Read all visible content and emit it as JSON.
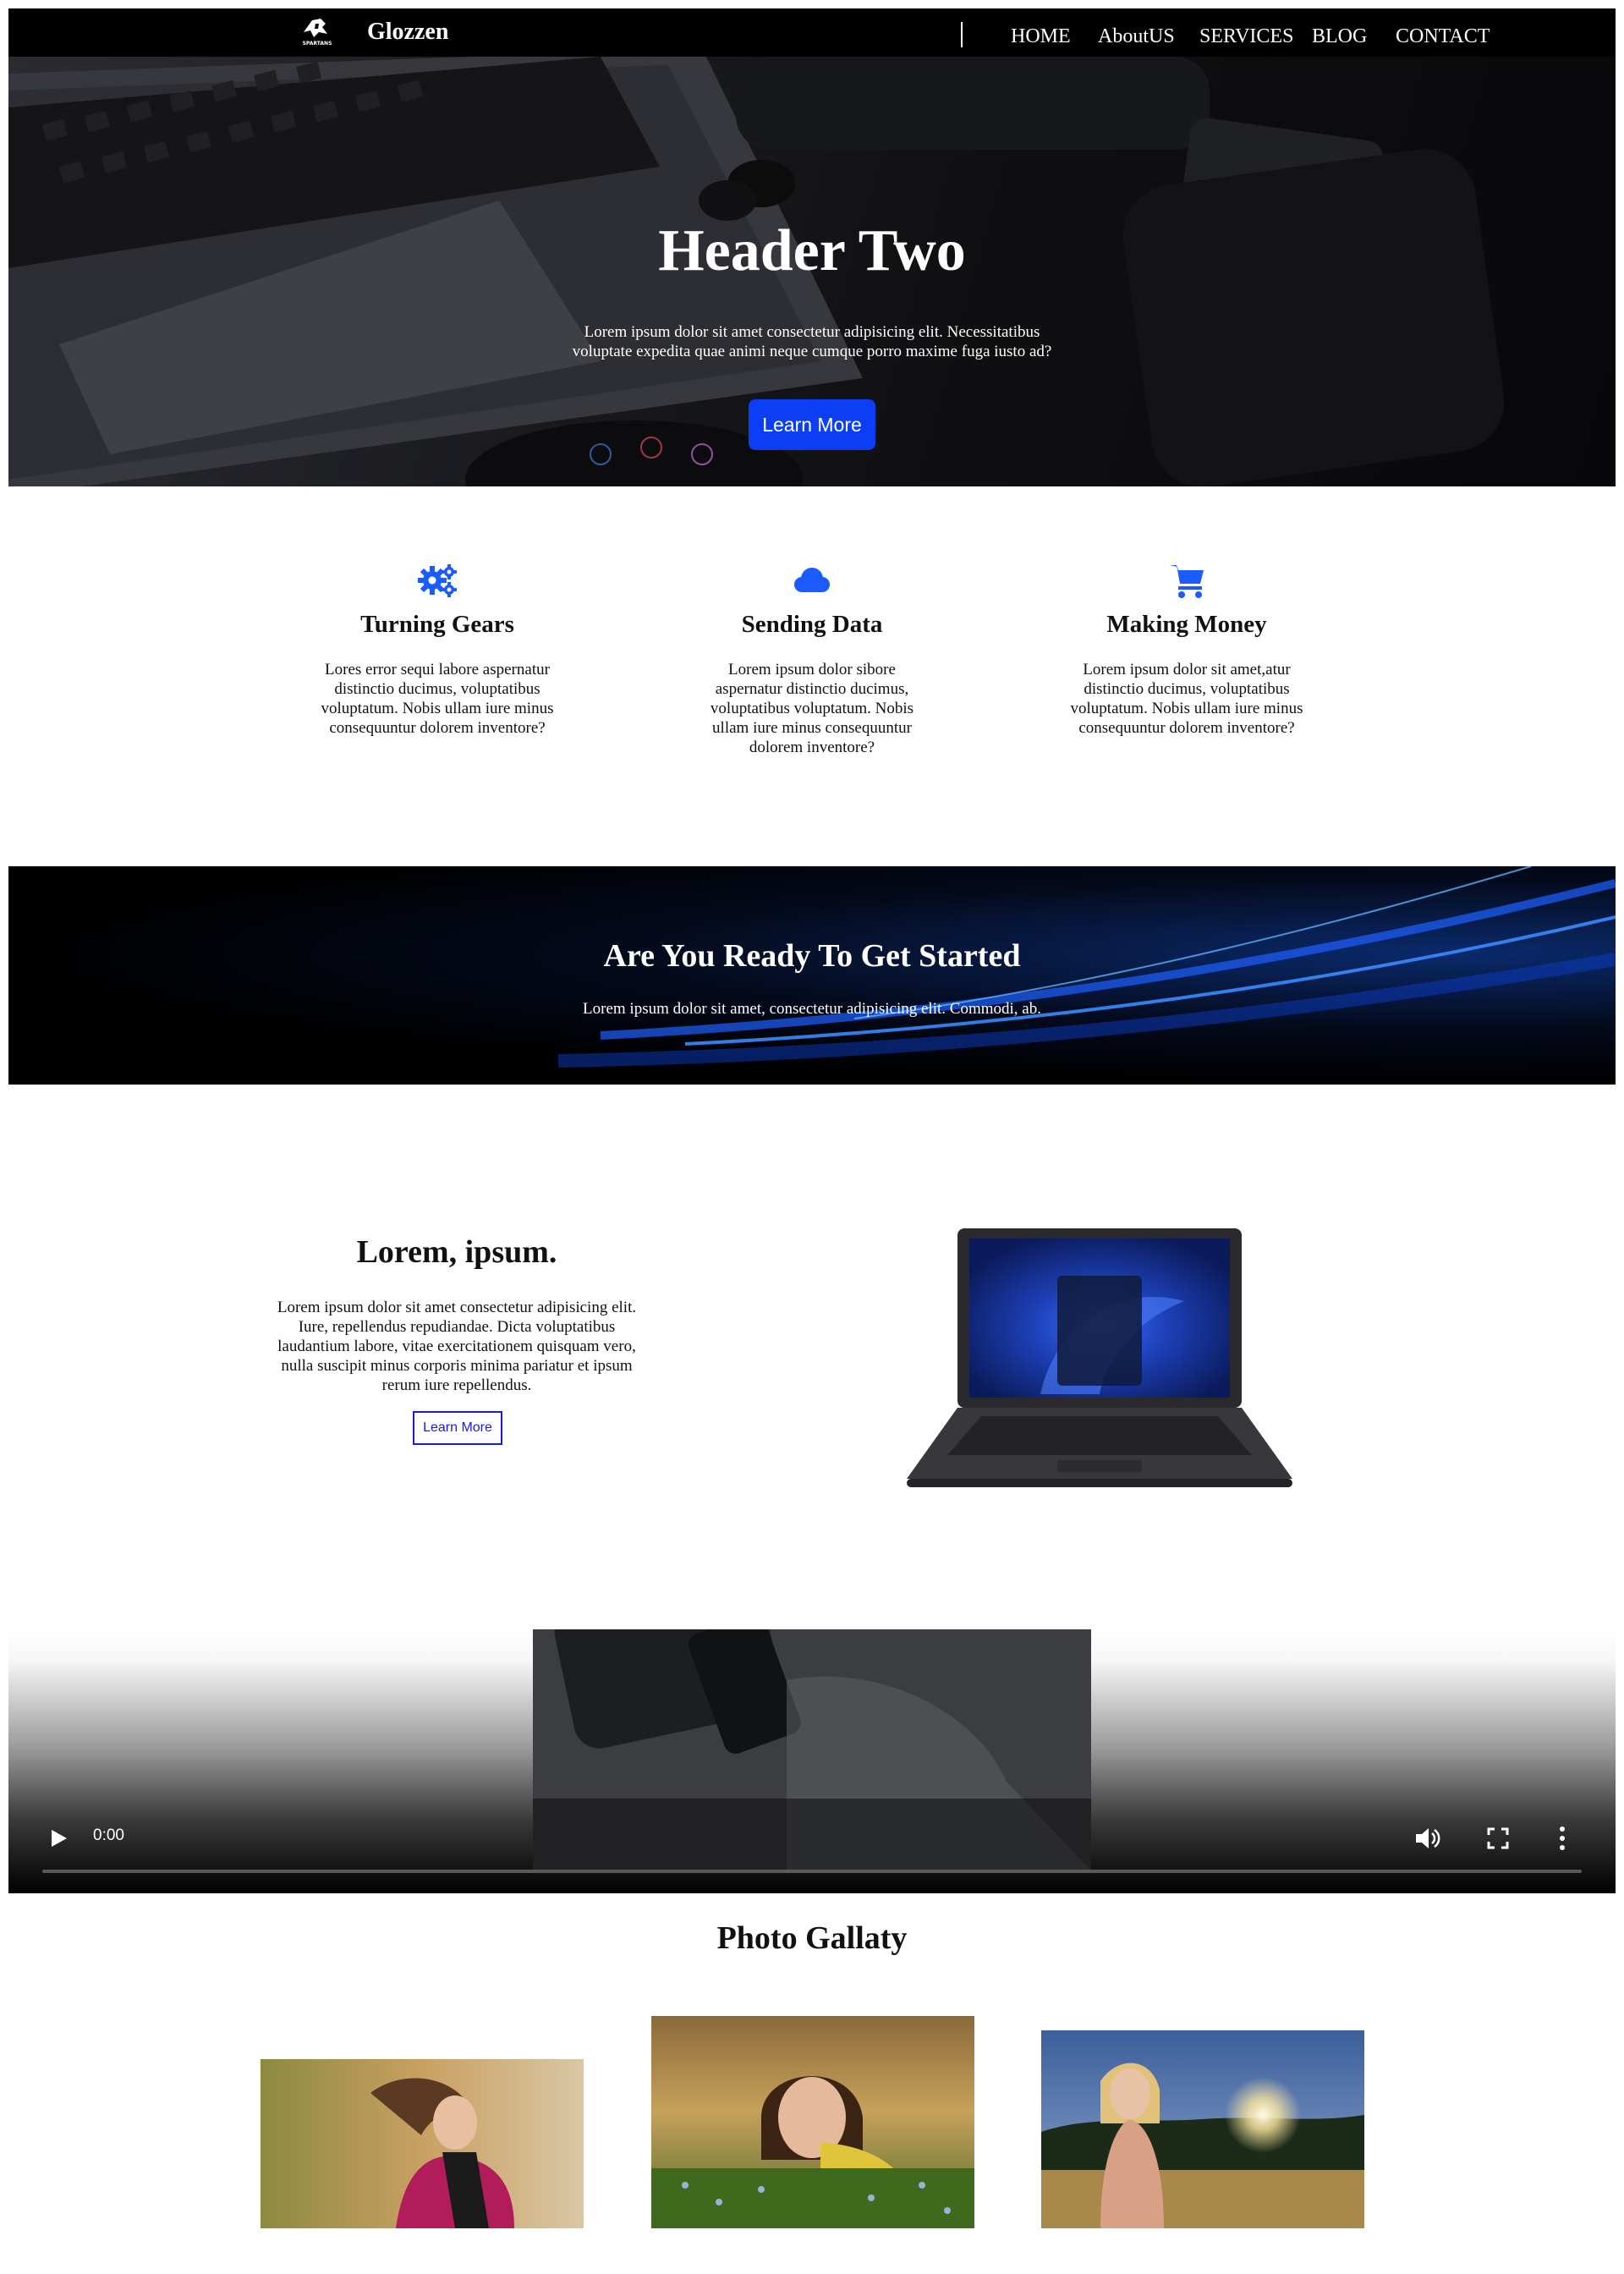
{
  "navbar": {
    "brand": "Glozzen",
    "logo_text": "SPARTANS",
    "links": [
      "HOME",
      "AboutUS",
      "SERVICES",
      "BLOG",
      "CONTACT"
    ]
  },
  "hero": {
    "title": "Header Two",
    "text": "Lorem ipsum dolor sit amet consectetur adipisicing elit. Necessitatibus voluptate expedita quae animi neque cumque porro maxime fuga iusto ad?",
    "button": "Learn More"
  },
  "features": [
    {
      "icon": "gears-icon",
      "title": "Turning Gears",
      "text": "Lores error sequi labore aspernatur distinctio ducimus, voluptatibus voluptatum. Nobis ullam iure minus consequuntur dolorem inventore?"
    },
    {
      "icon": "cloud-icon",
      "title": "Sending Data",
      "text": "Lorem ipsum dolor sibore aspernatur distinctio ducimus, voluptatibus voluptatum. Nobis ullam iure minus consequuntur dolorem inventore?"
    },
    {
      "icon": "cart-icon",
      "title": "Making Money",
      "text": "Lorem ipsum dolor sit amet,atur distinctio ducimus, voluptatibus voluptatum. Nobis ullam iure minus consequuntur dolorem inventore?"
    }
  ],
  "cta": {
    "title": "Are You Ready To Get Started",
    "text": "Lorem ipsum dolor sit amet, consectetur adipisicing elit. Commodi, ab."
  },
  "lorem": {
    "title": "Lorem, ipsum.",
    "text": "Lorem ipsum dolor sit amet consectetur adipisicing elit. Iure, repellendus repudiandae. Dicta voluptatibus laudantium labore, vitae exercitationem quisquam vero, nulla suscipit minus corporis minima pariatur et ipsum rerum iure repellendus.",
    "button": "Learn More"
  },
  "video": {
    "time": "0:00",
    "progress": 0
  },
  "gallery": {
    "title": "Photo Gallaty"
  },
  "colors": {
    "accent": "#0c3ff5",
    "icon_blue": "#1a5cff",
    "outline_button": "#1a1ae0"
  }
}
